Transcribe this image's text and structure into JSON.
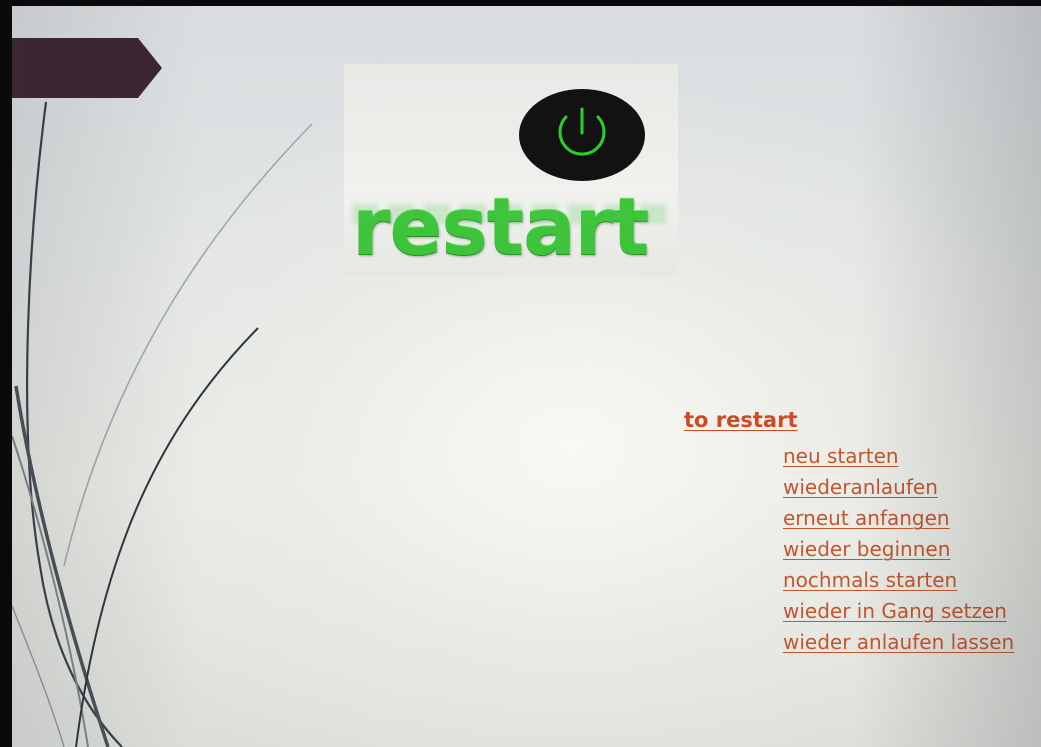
{
  "logo": {
    "text": "restart",
    "icon": "power-icon",
    "colors": {
      "word": "#3ec43a",
      "icon_ring": "#2bd12b",
      "icon_disc": "#121212"
    }
  },
  "title_tab": {
    "color": "#3b2430"
  },
  "vocabulary": {
    "term": "to restart",
    "term_color": "#cf4a22",
    "translations": [
      "neu starten",
      "wiederanlaufen",
      "erneut anfangen",
      "wieder beginnen",
      "nochmals starten",
      "wieder in Gang setzen",
      "wieder anlaufen lassen"
    ],
    "translation_color": "#c2562e"
  }
}
